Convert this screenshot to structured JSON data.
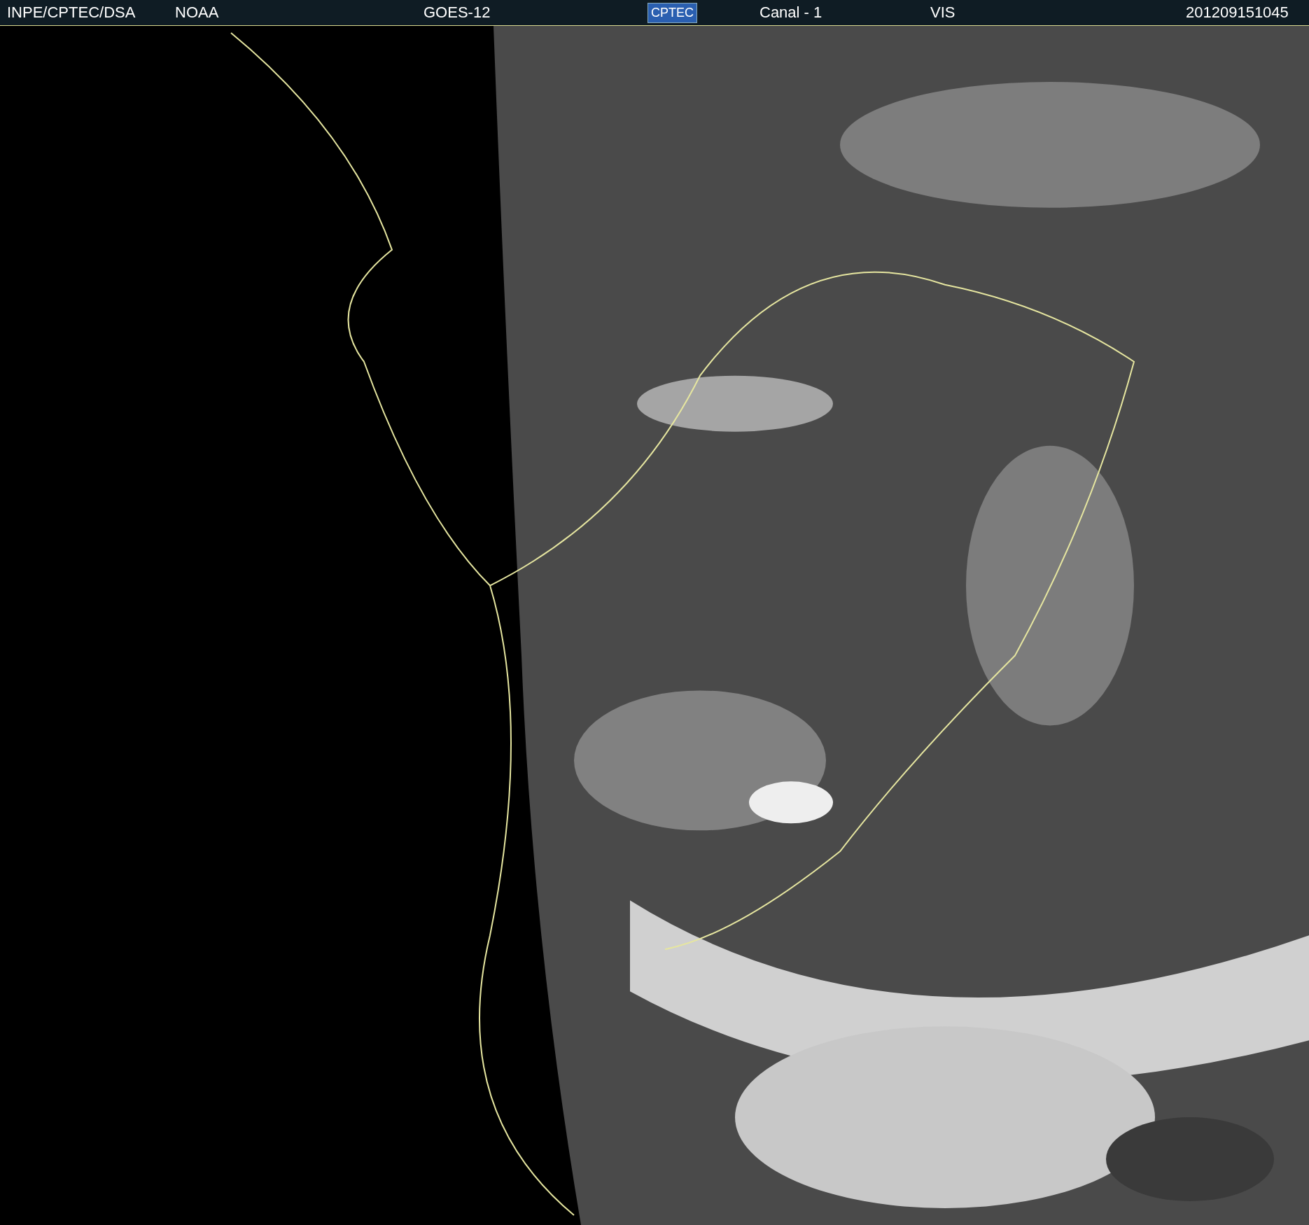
{
  "header": {
    "items": [
      {
        "kind": "text",
        "text": "INPE/CPTEC/DSA"
      },
      {
        "kind": "text",
        "text": "NOAA"
      },
      {
        "kind": "text",
        "text": "GOES-12"
      },
      {
        "kind": "logo",
        "text": "CPTEC"
      },
      {
        "kind": "text",
        "text": "Canal - 1"
      },
      {
        "kind": "text",
        "text": "VIS"
      },
      {
        "kind": "text",
        "text": "201209151045"
      }
    ]
  }
}
